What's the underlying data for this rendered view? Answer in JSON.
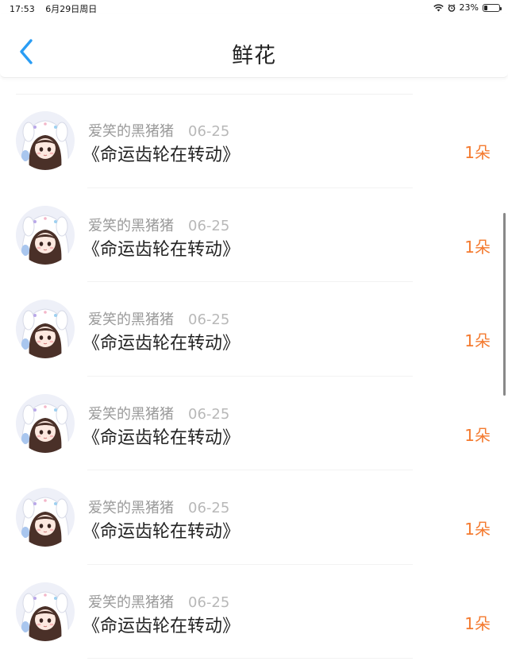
{
  "status_bar": {
    "time": "17:53",
    "date": "6月29日周日",
    "battery": "23%",
    "battery_level": 0.23
  },
  "nav": {
    "title": "鲜花",
    "back_icon": "chevron-left-icon",
    "accent": "#2a9df4"
  },
  "items": [
    {
      "user": "爱笑的黑猪猪",
      "date": "06-25",
      "title": "《命运齿轮在转动》",
      "amount": "1朵"
    },
    {
      "user": "爱笑的黑猪猪",
      "date": "06-25",
      "title": "《命运齿轮在转动》",
      "amount": "1朵"
    },
    {
      "user": "爱笑的黑猪猪",
      "date": "06-25",
      "title": "《命运齿轮在转动》",
      "amount": "1朵"
    },
    {
      "user": "爱笑的黑猪猪",
      "date": "06-25",
      "title": "《命运齿轮在转动》",
      "amount": "1朵"
    },
    {
      "user": "爱笑的黑猪猪",
      "date": "06-25",
      "title": "《命运齿轮在转动》",
      "amount": "1朵"
    },
    {
      "user": "爱笑的黑猪猪",
      "date": "06-25",
      "title": "《命运齿轮在转动》",
      "amount": "1朵"
    }
  ],
  "colors": {
    "amount": "#f47a2f",
    "meta": "#9a9a9a"
  }
}
